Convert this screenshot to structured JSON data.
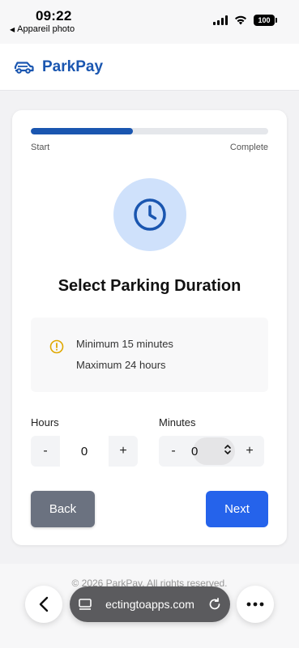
{
  "status_bar": {
    "time": "09:22",
    "back_app": "Appareil photo",
    "battery": "100"
  },
  "header": {
    "brand": "ParkPay",
    "logo_icon": "car-icon"
  },
  "progress": {
    "fraction": 0.43,
    "start_label": "Start",
    "end_label": "Complete"
  },
  "hero_icon": "clock-icon",
  "title": "Select Parking Duration",
  "info": {
    "icon": "warning-circle-icon",
    "lines": [
      "Minimum 15 minutes",
      "Maximum 24 hours"
    ]
  },
  "hours": {
    "label": "Hours",
    "minus": "-",
    "value": "0",
    "plus": "+"
  },
  "minutes": {
    "label": "Minutes",
    "minus": "-",
    "value": "0",
    "plus": "+"
  },
  "buttons": {
    "back": "Back",
    "next": "Next"
  },
  "footer": {
    "copyright": "© 2026 ParkPay. All rights reserved."
  },
  "browser": {
    "url": "ectingtoapps.com"
  },
  "colors": {
    "brand": "#1a56b0",
    "primary_button": "#2563eb",
    "secondary_button": "#6b7280",
    "warning": "#e0a800"
  }
}
